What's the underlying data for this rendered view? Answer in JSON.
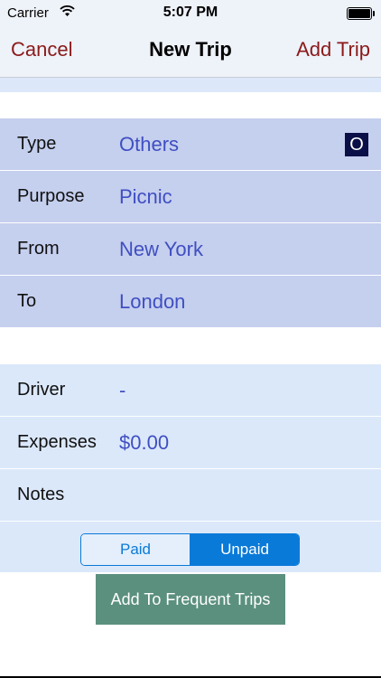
{
  "status_bar": {
    "carrier": "Carrier",
    "time": "5:07 PM"
  },
  "nav": {
    "cancel_label": "Cancel",
    "title": "New Trip",
    "add_label": "Add Trip"
  },
  "trip_fields": [
    {
      "label": "Type",
      "value": "Others",
      "badge": "O"
    },
    {
      "label": "Purpose",
      "value": "Picnic"
    },
    {
      "label": "From",
      "value": "New York"
    },
    {
      "label": "To",
      "value": "London"
    }
  ],
  "detail_fields": [
    {
      "label": "Driver",
      "value": "-"
    },
    {
      "label": "Expenses",
      "value": "$0.00"
    },
    {
      "label": "Notes",
      "value": ""
    }
  ],
  "payment": {
    "options": [
      "Paid",
      "Unpaid"
    ],
    "selected": "Unpaid"
  },
  "action_button": "Add To Frequent Trips",
  "colors": {
    "accent_red": "#8b1a1a",
    "value_blue": "#3f4fc2",
    "segment_blue": "#0a7ad8",
    "button_green": "#5b907e"
  }
}
